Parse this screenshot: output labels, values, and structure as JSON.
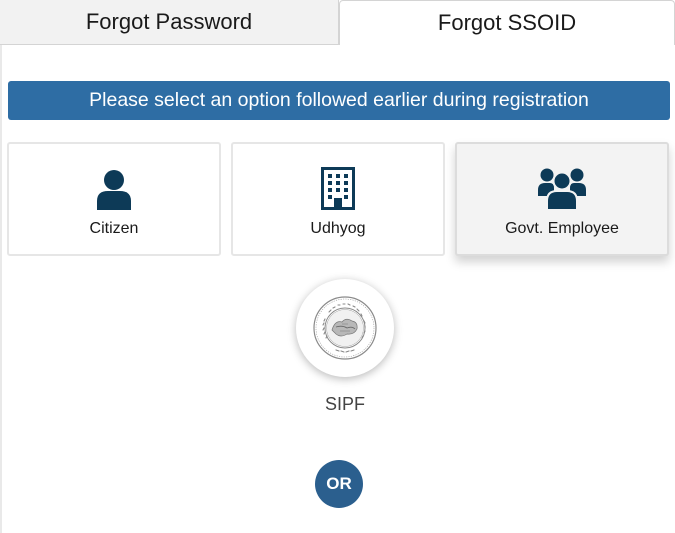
{
  "tabs": [
    {
      "label": "Forgot Password"
    },
    {
      "label": "Forgot SSOID"
    }
  ],
  "banner": {
    "text": "Please select an option followed earlier during registration"
  },
  "options": [
    {
      "label": "Citizen",
      "icon": "user-icon"
    },
    {
      "label": "Udhyog",
      "icon": "building-icon"
    },
    {
      "label": "Govt. Employee",
      "icon": "users-group-icon"
    }
  ],
  "sipf": {
    "label": "SIPF",
    "icon": "sipf-seal-logo"
  },
  "divider": {
    "text": "OR"
  },
  "colors": {
    "banner": "#2e6da4",
    "icon": "#0d3a57",
    "or_badge": "#2b5f8e"
  }
}
